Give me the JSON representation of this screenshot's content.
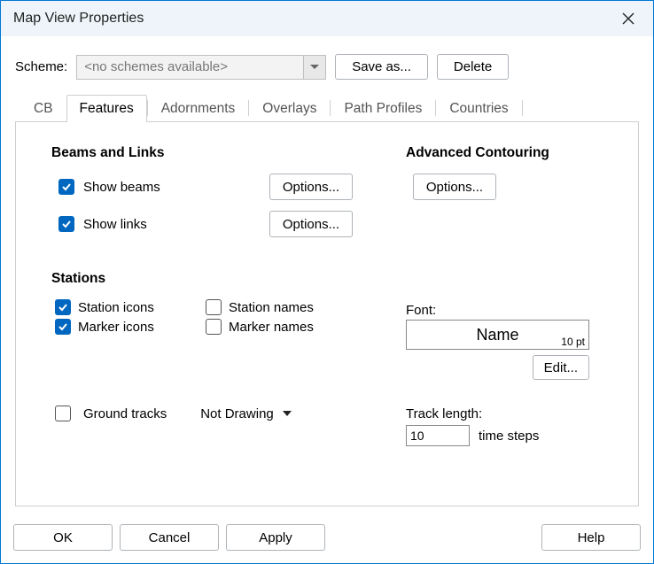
{
  "title": "Map View Properties",
  "scheme": {
    "label": "Scheme:",
    "selected": "<no schemes available>",
    "save_as": "Save as...",
    "delete": "Delete"
  },
  "tabs": [
    "CB",
    "Features",
    "Adornments",
    "Overlays",
    "Path Profiles",
    "Countries"
  ],
  "active_tab": "Features",
  "sections": {
    "beams_links": {
      "head": "Beams and Links",
      "show_beams": "Show beams",
      "show_links": "Show links",
      "options": "Options..."
    },
    "stations": {
      "head": "Stations",
      "station_icons": "Station icons",
      "station_names": "Station names",
      "marker_icons": "Marker icons",
      "marker_names": "Marker names",
      "ground_tracks": "Ground tracks",
      "drawing_mode": "Not Drawing"
    },
    "advanced": {
      "head": "Advanced Contouring",
      "options": "Options..."
    },
    "font": {
      "label": "Font:",
      "name": "Name",
      "size": "10 pt",
      "edit": "Edit..."
    },
    "track": {
      "label": "Track length:",
      "value": "10",
      "unit": "time steps"
    }
  },
  "checked": {
    "show_beams": true,
    "show_links": true,
    "station_icons": true,
    "station_names": false,
    "marker_icons": true,
    "marker_names": false,
    "ground_tracks": false
  },
  "footer": {
    "ok": "OK",
    "cancel": "Cancel",
    "apply": "Apply",
    "help": "Help"
  }
}
